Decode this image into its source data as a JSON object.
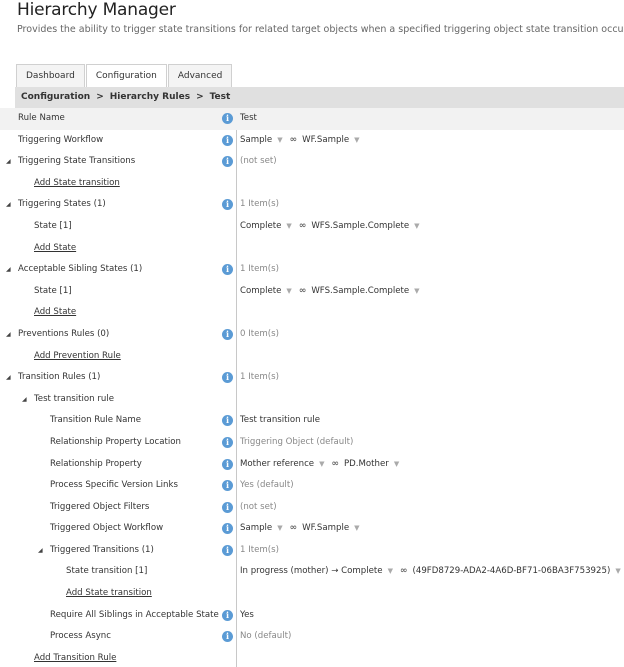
{
  "header": {
    "title": "Hierarchy Manager",
    "subtitle": "Provides the ability to trigger state transitions for related target objects when a specified triggering object state transition occurs."
  },
  "tabs": [
    {
      "label": "Dashboard"
    },
    {
      "label": "Configuration"
    },
    {
      "label": "Advanced"
    }
  ],
  "breadcrumb": {
    "items": [
      "Configuration",
      "Hierarchy Rules",
      "Test"
    ],
    "separator": ">"
  },
  "rows": [
    {
      "label": "Rule Name",
      "value": "Test"
    },
    {
      "label": "Triggering Workflow",
      "value_a": "Sample",
      "value_b": "WF.Sample"
    },
    {
      "label": "Triggering State Transitions",
      "value": "(not set)"
    },
    {
      "label": "Add State transition"
    },
    {
      "label": "Triggering States (1)",
      "value": "1 Item(s)"
    },
    {
      "label": "State [1]",
      "value_a": "Complete",
      "value_b": "WFS.Sample.Complete"
    },
    {
      "label": "Add State"
    },
    {
      "label": "Acceptable Sibling States (1)",
      "value": "1 Item(s)"
    },
    {
      "label": "State [1]",
      "value_a": "Complete",
      "value_b": "WFS.Sample.Complete"
    },
    {
      "label": "Add State"
    },
    {
      "label": "Preventions Rules (0)",
      "value": "0 Item(s)"
    },
    {
      "label": "Add Prevention Rule"
    },
    {
      "label": "Transition Rules (1)",
      "value": "1 Item(s)"
    },
    {
      "label": "Test transition rule"
    },
    {
      "label": "Transition Rule Name",
      "value": "Test transition rule"
    },
    {
      "label": "Relationship Property Location",
      "value": "Triggering Object (default)"
    },
    {
      "label": "Relationship Property",
      "value_a": "Mother reference",
      "value_b": "PD.Mother"
    },
    {
      "label": "Process Specific Version Links",
      "value": "Yes (default)"
    },
    {
      "label": "Triggered Object Filters",
      "value": "(not set)"
    },
    {
      "label": "Triggered Object Workflow",
      "value_a": "Sample",
      "value_b": "WF.Sample"
    },
    {
      "label": "Triggered Transitions (1)",
      "value": "1 Item(s)"
    },
    {
      "label": "State transition [1]",
      "value_a": "In progress (mother) → Complete",
      "value_b": "(49FD8729-ADA2-4A6D-BF71-06BA3F753925)"
    },
    {
      "label": "Add State transition"
    },
    {
      "label": "Require All Siblings in Acceptable State",
      "value": "Yes"
    },
    {
      "label": "Process Async",
      "value": "No (default)"
    },
    {
      "label": "Add Transition Rule"
    }
  ],
  "icons": {
    "info": "i",
    "expanded": "◢",
    "dropdown": "▼",
    "link": "∞"
  }
}
